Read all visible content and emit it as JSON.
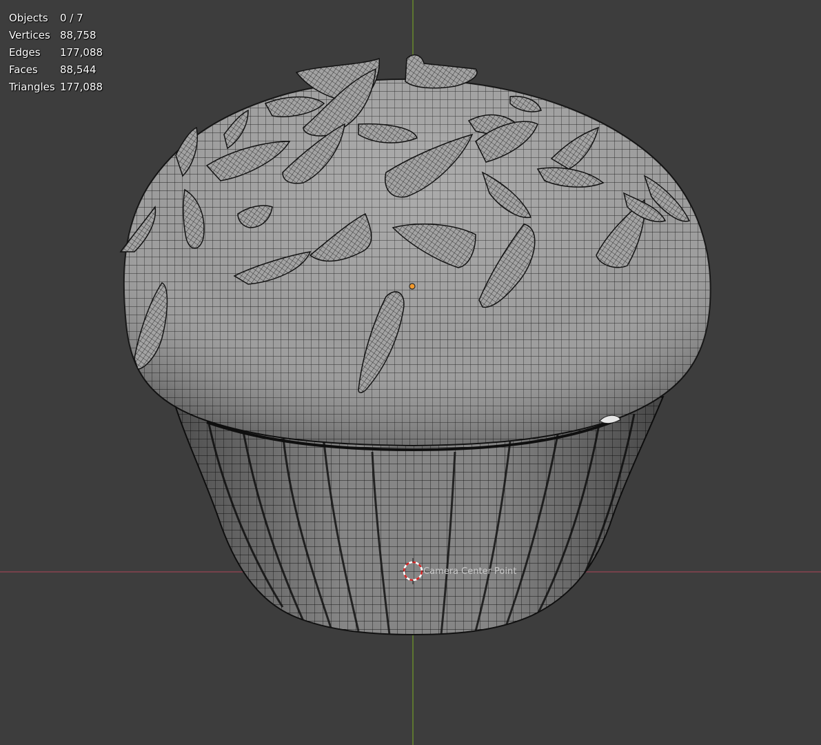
{
  "viewport": {
    "background": "#3d3d3d",
    "x_axis_color": "#8a4350",
    "y_axis_color": "#66892d",
    "origin_color": "#f29a2e",
    "cursor_colors": [
      "#ffffff",
      "#d32424"
    ],
    "wire_color": "#111111",
    "surface_color": "#8f8f8f"
  },
  "stats": [
    {
      "label": "Objects",
      "value": "0 / 7"
    },
    {
      "label": "Vertices",
      "value": "88,758"
    },
    {
      "label": "Edges",
      "value": "177,088"
    },
    {
      "label": "Faces",
      "value": "88,544"
    },
    {
      "label": "Triangles",
      "value": "177,088"
    }
  ],
  "scene": {
    "object": "cupcake-mesh",
    "overlay_mode": "wireframe",
    "camera_label": "Camera Center Point",
    "cursor_icon": "3d-cursor-icon",
    "origin_icon": "object-origin-icon"
  }
}
